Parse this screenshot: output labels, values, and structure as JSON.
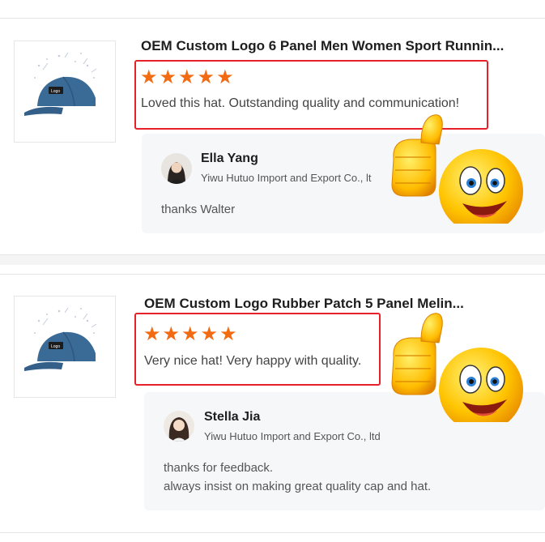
{
  "reviews": [
    {
      "product_title": "OEM Custom Logo 6 Panel Men Women Sport Runnin...",
      "rating": 5,
      "stars": "★★★★★",
      "comment": "Loved this hat. Outstanding quality and communication!",
      "reply": {
        "seller_name": "Ella Yang",
        "company": "Yiwu Hutuo Import and Export Co., lt",
        "lines": [
          "thanks Walter"
        ]
      }
    },
    {
      "product_title": "OEM Custom Logo Rubber Patch 5 Panel Melin...",
      "rating": 5,
      "stars": "★★★★★",
      "comment": "Very nice hat! Very happy with quality.",
      "reply": {
        "seller_name": "Stella Jia",
        "company": "Yiwu Hutuo Import and Export Co., ltd",
        "lines": [
          "thanks for feedback.",
          "always insist on making great quality cap and hat."
        ]
      }
    }
  ],
  "colors": {
    "star": "#f26b12",
    "highlight": "#e8202a",
    "cap": "#3a6a96"
  },
  "icons": {
    "emoji": "thumbs-up-smiley-icon"
  }
}
